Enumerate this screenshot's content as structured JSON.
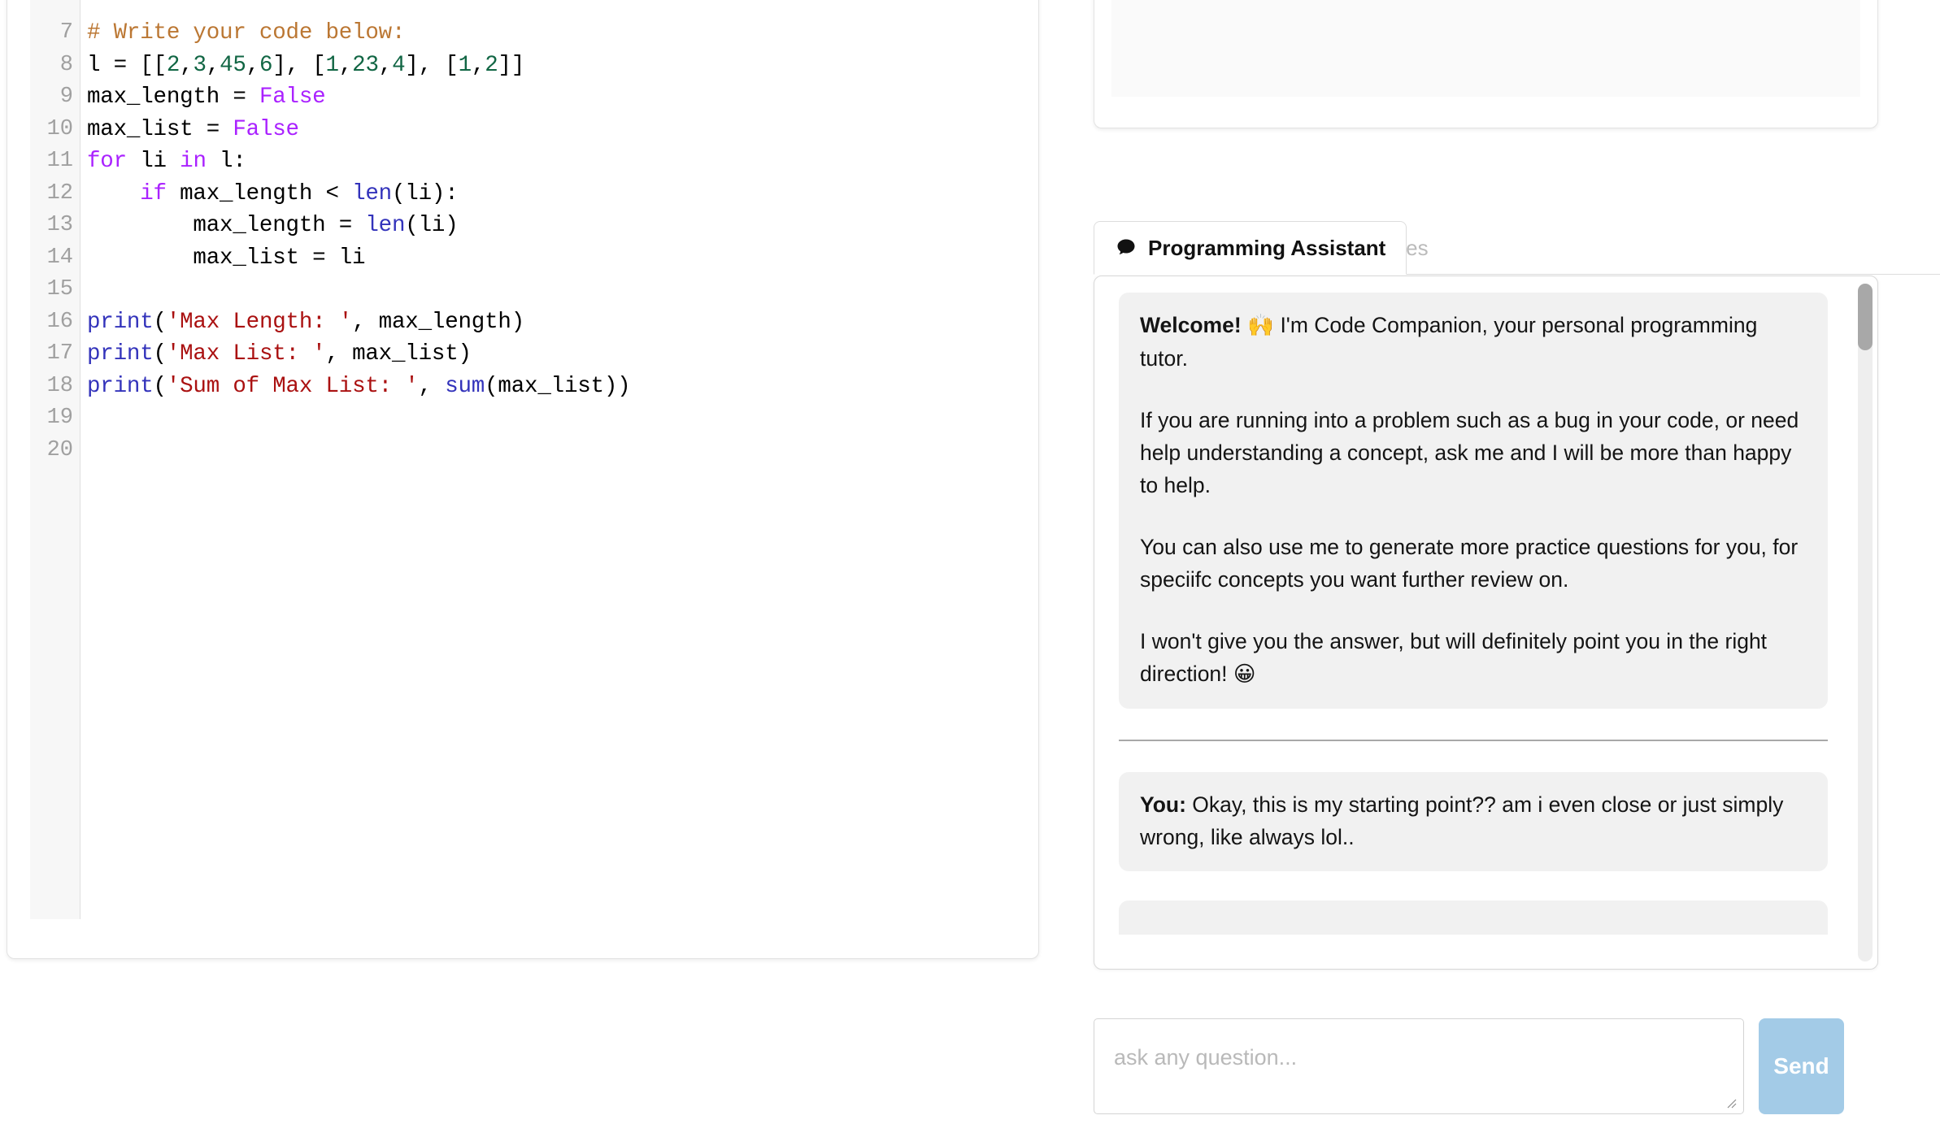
{
  "editor": {
    "language": "python",
    "gutter_line_numbers": [
      "7",
      "8",
      "9",
      "10",
      "11",
      "12",
      "13",
      "14",
      "15",
      "16",
      "17",
      "18",
      "19",
      "20"
    ],
    "lines": [
      {
        "number": "7",
        "text": "# Write your code below:"
      },
      {
        "number": "8",
        "text": "l = [[2,3,45,6], [1,23,4], [1,2]]"
      },
      {
        "number": "9",
        "text": "max_length = False"
      },
      {
        "number": "10",
        "text": "max_list = False"
      },
      {
        "number": "11",
        "text": "for li in l:"
      },
      {
        "number": "12",
        "text": "    if max_length < len(li):"
      },
      {
        "number": "13",
        "text": "        max_length = len(li)"
      },
      {
        "number": "14",
        "text": "        max_list = li"
      },
      {
        "number": "15",
        "text": ""
      },
      {
        "number": "16",
        "text": "print('Max Length: ', max_length)"
      },
      {
        "number": "17",
        "text": "print('Max List: ', max_list)"
      },
      {
        "number": "18",
        "text": "print('Sum of Max List: ', sum(max_list))"
      },
      {
        "number": "19",
        "text": ""
      },
      {
        "number": "20",
        "text": ""
      }
    ],
    "syntax_colors": {
      "comment": "#bb7733",
      "number": "#116644",
      "keyword": "#aa22ff",
      "builtin": "#3333bb",
      "string": "#aa1111",
      "plain": "#000000",
      "line_number": "#a0a0a0",
      "gutter_background": "#f7f7f7"
    }
  },
  "tabs": [
    {
      "id": "programming-assistant",
      "label": "Programming Assistant",
      "icon": "chat-bubble-icon",
      "active": true
    },
    {
      "id": "test-cases",
      "label": "Test Cases",
      "icon": "bug-icon",
      "active": false
    }
  ],
  "chat": {
    "messages": [
      {
        "sender": "assistant",
        "sender_label": "Welcome!",
        "paragraphs": [
          {
            "bold_prefix": "Welcome!",
            "emoji": "🙌",
            "text": "I'm Code Companion, your personal programming tutor."
          },
          {
            "bold_prefix": "",
            "emoji": "",
            "text": "If you are running into a problem such as a bug in your code, or need help understanding a concept, ask me and I will be more than happy to help."
          },
          {
            "bold_prefix": "",
            "emoji": "",
            "text": "You can also use me to generate more practice questions for you, for speciifc concepts you want further review on."
          },
          {
            "bold_prefix": "",
            "emoji_suffix": "😀",
            "text": "I won't give you the answer, but will definitely point you in the right direction!"
          }
        ]
      },
      {
        "sender": "user",
        "sender_label": "You:",
        "text": "Okay, this is my starting point?? am i even close or just simply wrong, like always lol.."
      }
    ],
    "scrollbar": {
      "thumb_color": "#a8a8a8",
      "track_color": "#eeeeee"
    }
  },
  "composer": {
    "placeholder": "ask any question...",
    "value": "",
    "send_label": "Send",
    "send_color": "#a3cbe7"
  }
}
